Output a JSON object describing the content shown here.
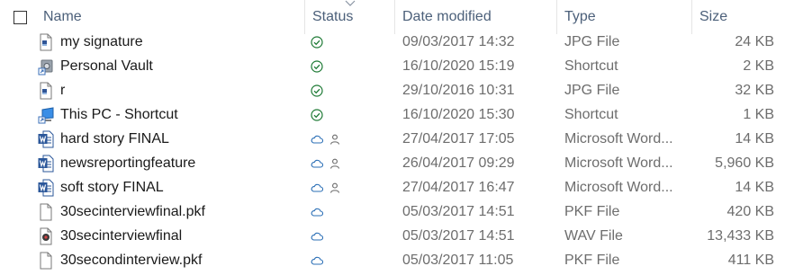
{
  "columns": {
    "name": "Name",
    "status": "Status",
    "date": "Date modified",
    "type": "Type",
    "size": "Size"
  },
  "colors": {
    "header_text": "#4c607a",
    "synced_green": "#1e7a35",
    "cloud_blue": "#2b6fb6",
    "word_blue": "#2b579a"
  },
  "files": [
    {
      "name": "my signature",
      "icon": "image-file-icon",
      "status": [
        "synced-check-icon"
      ],
      "date": "09/03/2017 14:32",
      "type": "JPG File",
      "size": "24 KB"
    },
    {
      "name": "Personal Vault",
      "icon": "vault-shortcut-icon",
      "status": [
        "synced-check-icon"
      ],
      "date": "16/10/2020 15:19",
      "type": "Shortcut",
      "size": "2 KB"
    },
    {
      "name": "r",
      "icon": "image-file-icon",
      "status": [
        "synced-check-icon"
      ],
      "date": "29/10/2016 10:31",
      "type": "JPG File",
      "size": "32 KB"
    },
    {
      "name": "This PC - Shortcut",
      "icon": "pc-shortcut-icon",
      "status": [
        "synced-check-icon"
      ],
      "date": "16/10/2020 15:30",
      "type": "Shortcut",
      "size": "1 KB"
    },
    {
      "name": "hard story FINAL",
      "icon": "word-doc-icon",
      "status": [
        "cloud-icon",
        "shared-person-icon"
      ],
      "date": "27/04/2017 17:05",
      "type": "Microsoft Word...",
      "size": "14 KB"
    },
    {
      "name": "newsreportingfeature",
      "icon": "word-doc-icon",
      "status": [
        "cloud-icon",
        "shared-person-icon"
      ],
      "date": "26/04/2017 09:29",
      "type": "Microsoft Word...",
      "size": "5,960 KB"
    },
    {
      "name": "soft story FINAL",
      "icon": "word-doc-icon",
      "status": [
        "cloud-icon",
        "shared-person-icon"
      ],
      "date": "27/04/2017 16:47",
      "type": "Microsoft Word...",
      "size": "14 KB"
    },
    {
      "name": "30secinterviewfinal.pkf",
      "icon": "generic-file-icon",
      "status": [
        "cloud-icon"
      ],
      "date": "05/03/2017 14:51",
      "type": "PKF File",
      "size": "420 KB"
    },
    {
      "name": "30secinterviewfinal",
      "icon": "audio-file-icon",
      "status": [
        "cloud-icon"
      ],
      "date": "05/03/2017 14:51",
      "type": "WAV File",
      "size": "13,433 KB"
    },
    {
      "name": "30secondinterview.pkf",
      "icon": "generic-file-icon",
      "status": [
        "cloud-icon"
      ],
      "date": "05/03/2017 11:05",
      "type": "PKF File",
      "size": "411 KB"
    }
  ]
}
